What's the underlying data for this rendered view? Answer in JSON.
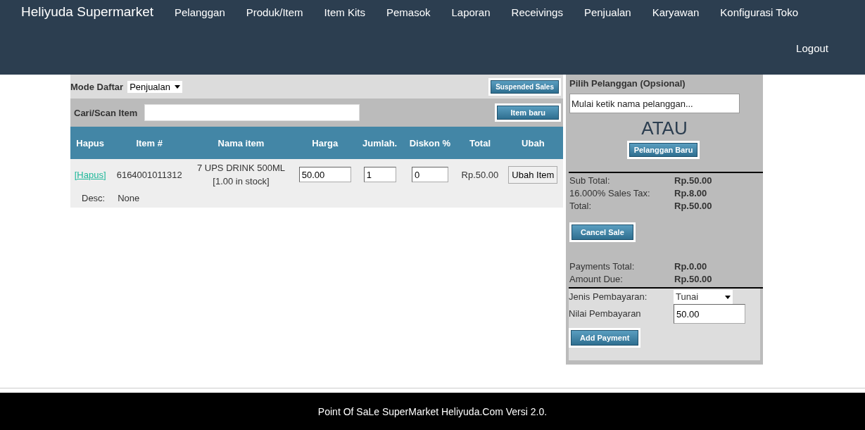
{
  "brand": "Heliyuda Supermarket",
  "nav": [
    "Pelanggan",
    "Produk/Item",
    "Item Kits",
    "Pemasok",
    "Laporan",
    "Receivings",
    "Penjualan",
    "Karyawan",
    "Konfigurasi Toko"
  ],
  "logout": "Logout",
  "register": {
    "mode_label": "Mode Daftar",
    "mode_value": "Penjualan",
    "suspended_button": "Suspended Sales",
    "search_label": "Cari/Scan Item",
    "new_item_button": "Item baru"
  },
  "table": {
    "columns": [
      "Hapus",
      "Item #",
      "Nama item",
      "Harga",
      "Jumlah.",
      "Diskon %",
      "Total",
      "Ubah"
    ],
    "rows": [
      {
        "delete_link": "[Hapus]",
        "item_number": "6164001011312",
        "name": "7 UPS DRINK 500ML",
        "stock": "[1.00 in stock]",
        "price": "50.00",
        "quantity": "1",
        "discount": "0",
        "total": "Rp.50.00",
        "edit_button": "Ubah Item",
        "desc_label": "Desc:",
        "desc_value": "None"
      }
    ]
  },
  "customer": {
    "title": "Pilih Pelanggan (Opsional)",
    "placeholder": "Mulai ketik nama pelanggan...",
    "or_text": "ATAU",
    "new_customer_button": "Pelanggan Baru"
  },
  "totals": [
    {
      "label": "Sub Total:",
      "value": "Rp.50.00"
    },
    {
      "label": "16.000% Sales Tax:",
      "value": "Rp.8.00"
    },
    {
      "label": "Total:",
      "value": "Rp.50.00"
    }
  ],
  "cancel_button": "Cancel Sale",
  "payments": [
    {
      "label": "Payments Total:",
      "value": "Rp.0.00"
    },
    {
      "label": "Amount Due:",
      "value": "Rp.50.00"
    }
  ],
  "payment_form": {
    "type_label": "Jenis Pembayaran:",
    "type_value": "Tunai",
    "amount_label": "Nilai Pembayaran",
    "amount_value": "50.00",
    "add_button": "Add Payment"
  },
  "footer": "Point Of SaLe SuperMarket Heliyuda.Com Versi 2.0."
}
